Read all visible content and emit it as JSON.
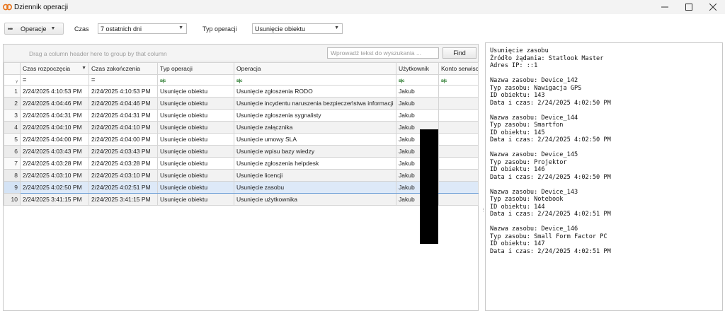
{
  "window": {
    "title": "Dziennik operacji",
    "icon": "chain-link-icon"
  },
  "toolbar": {
    "operations_label": "Operacje",
    "time_label": "Czas",
    "time_value": "7 ostatnich dni",
    "op_type_label": "Typ operacji",
    "op_type_value": "Usunięcie obiektu"
  },
  "grid": {
    "group_hint": "Drag a column header here to group by that column",
    "search_placeholder": "Wprowadź tekst do wyszukania ...",
    "find_label": "Find",
    "columns": [
      "Czas rozpoczęcia",
      "Czas zakończenia",
      "Typ operacji",
      "Operacja",
      "Użytkownik",
      "Konto serwisowe"
    ],
    "rows": [
      {
        "n": "1",
        "start": "2/24/2025 4:10:53 PM",
        "end": "2/24/2025 4:10:53 PM",
        "type": "Usunięcie obiektu",
        "op": "Usunięcie zgłoszenia RODO",
        "user": "Jakub"
      },
      {
        "n": "2",
        "start": "2/24/2025 4:04:46 PM",
        "end": "2/24/2025 4:04:46 PM",
        "type": "Usunięcie obiektu",
        "op": "Usunięcie incydentu naruszenia bezpieczeństwa informacji",
        "user": "Jakub"
      },
      {
        "n": "3",
        "start": "2/24/2025 4:04:31 PM",
        "end": "2/24/2025 4:04:31 PM",
        "type": "Usunięcie obiektu",
        "op": "Usunięcie zgłoszenia sygnalisty",
        "user": "Jakub"
      },
      {
        "n": "4",
        "start": "2/24/2025 4:04:10 PM",
        "end": "2/24/2025 4:04:10 PM",
        "type": "Usunięcie obiektu",
        "op": "Usunięcie załącznika",
        "user": "Jakub"
      },
      {
        "n": "5",
        "start": "2/24/2025 4:04:00 PM",
        "end": "2/24/2025 4:04:00 PM",
        "type": "Usunięcie obiektu",
        "op": "Usunięcie umowy SLA",
        "user": "Jakub"
      },
      {
        "n": "6",
        "start": "2/24/2025 4:03:43 PM",
        "end": "2/24/2025 4:03:43 PM",
        "type": "Usunięcie obiektu",
        "op": "Usunięcie wpisu bazy wiedzy",
        "user": "Jakub"
      },
      {
        "n": "7",
        "start": "2/24/2025 4:03:28 PM",
        "end": "2/24/2025 4:03:28 PM",
        "type": "Usunięcie obiektu",
        "op": "Usunięcie zgłoszenia helpdesk",
        "user": "Jakub"
      },
      {
        "n": "8",
        "start": "2/24/2025 4:03:10 PM",
        "end": "2/24/2025 4:03:10 PM",
        "type": "Usunięcie obiektu",
        "op": "Usunięcie licencji",
        "user": "Jakub"
      },
      {
        "n": "9",
        "start": "2/24/2025 4:02:50 PM",
        "end": "2/24/2025 4:02:51 PM",
        "type": "Usunięcie obiektu",
        "op": "Usunięcie zasobu",
        "user": "Jakub",
        "selected": true
      },
      {
        "n": "10",
        "start": "2/24/2025 3:41:15 PM",
        "end": "2/24/2025 3:41:15 PM",
        "type": "Usunięcie obiektu",
        "op": "Usunięcie użytkownika",
        "user": "Jakub"
      }
    ]
  },
  "details": {
    "header": [
      "Usunięcie zasobu",
      "Źródło żądania: Statlook Master",
      "Adres IP: ::1"
    ],
    "blocks": [
      [
        "Nazwa zasobu: Device_142",
        "Typ zasobu: Nawigacja GPS",
        "ID obiektu: 143",
        "Data i czas: 2/24/2025 4:02:50 PM"
      ],
      [
        "Nazwa zasobu: Device_144",
        "Typ zasobu: Smartfon",
        "ID obiektu: 145",
        "Data i czas: 2/24/2025 4:02:50 PM"
      ],
      [
        "Nazwa zasobu: Device_145",
        "Typ zasobu: Projektor",
        "ID obiektu: 146",
        "Data i czas: 2/24/2025 4:02:50 PM"
      ],
      [
        "Nazwa zasobu: Device_143",
        "Typ zasobu: Notebook",
        "ID obiektu: 144",
        "Data i czas: 2/24/2025 4:02:51 PM"
      ],
      [
        "Nazwa zasobu: Device_146",
        "Typ zasobu: Small Form Factor PC",
        "ID obiektu: 147",
        "Data i czas: 2/24/2025 4:02:51 PM"
      ]
    ]
  },
  "colors": {
    "selected_row": "#dde9f8",
    "accent_icon": "#e8731a"
  }
}
